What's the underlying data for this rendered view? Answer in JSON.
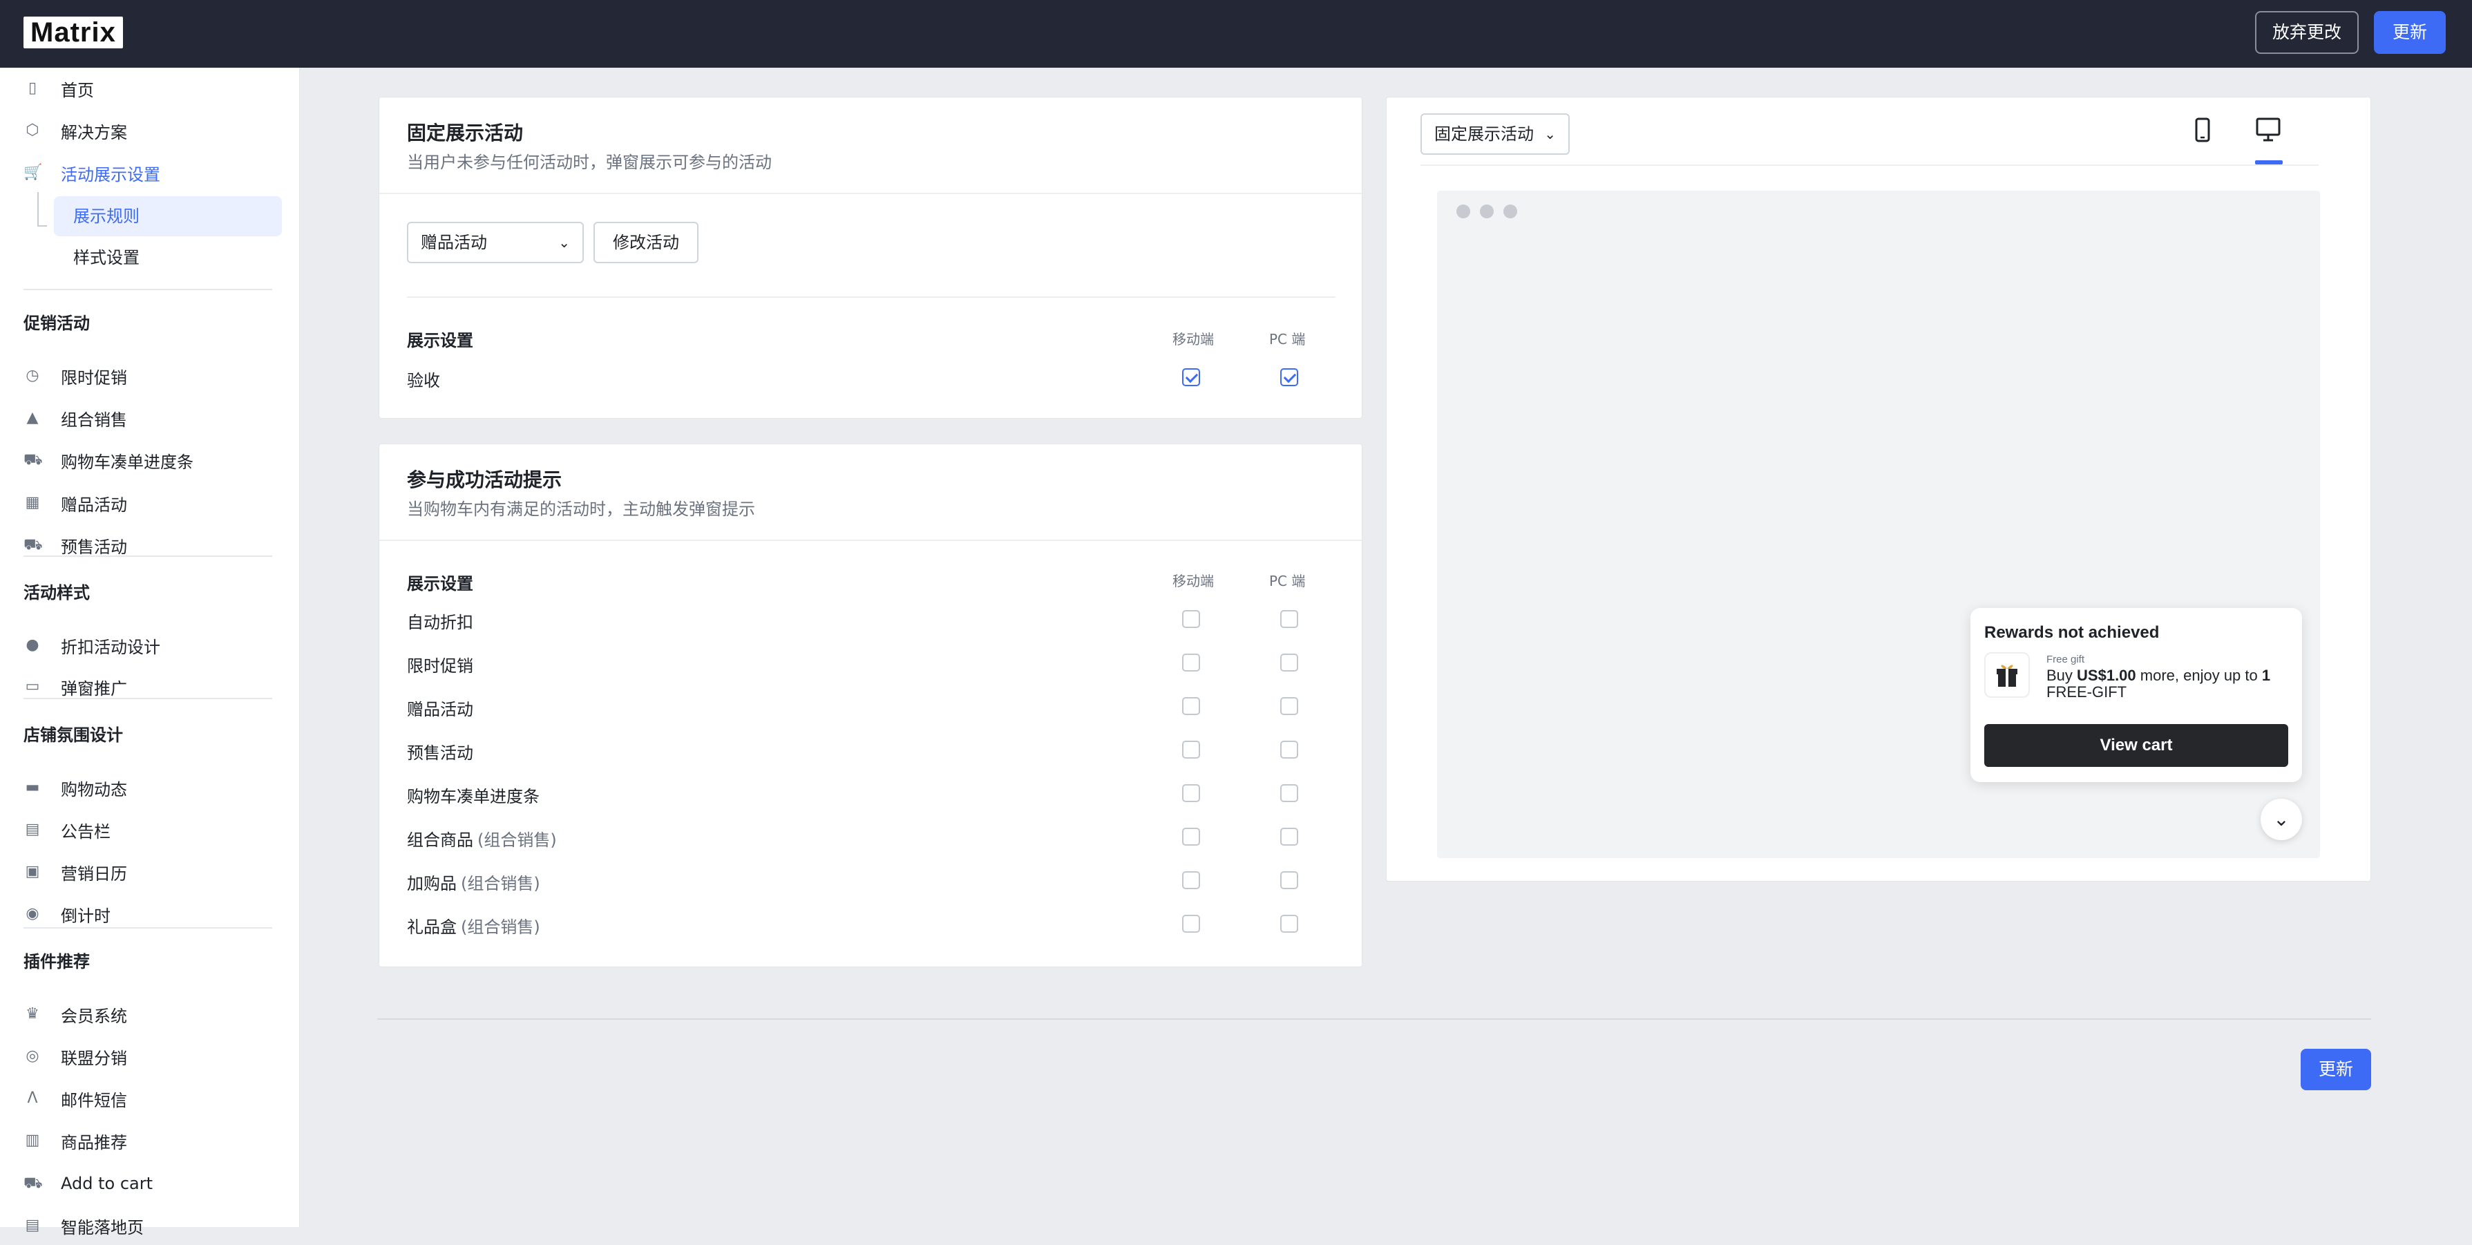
{
  "header": {
    "logo": "Matrix",
    "discard_label": "放弃更改",
    "update_label": "更新"
  },
  "sidebar": {
    "top_items": [
      {
        "label": "首页",
        "icon": "dashboard-icon"
      },
      {
        "label": "解决方案",
        "icon": "box-icon"
      },
      {
        "label": "活动展示设置",
        "icon": "cart-icon"
      }
    ],
    "sub_items": [
      {
        "label": "展示规则"
      },
      {
        "label": "样式设置"
      }
    ],
    "groups": [
      {
        "title": "促销活动",
        "items": [
          {
            "label": "限时促销",
            "icon": "clock-icon"
          },
          {
            "label": "组合销售",
            "icon": "bundle-icon"
          },
          {
            "label": "购物车凑单进度条",
            "icon": "cart-progress-icon"
          },
          {
            "label": "赠品活动",
            "icon": "gift-icon"
          },
          {
            "label": "预售活动",
            "icon": "presale-icon"
          }
        ]
      },
      {
        "title": "活动样式",
        "items": [
          {
            "label": "折扣活动设计",
            "icon": "discount-icon"
          },
          {
            "label": "弹窗推广",
            "icon": "popup-icon"
          }
        ]
      },
      {
        "title": "店铺氛围设计",
        "items": [
          {
            "label": "购物动态",
            "icon": "activity-icon"
          },
          {
            "label": "公告栏",
            "icon": "announcement-icon"
          },
          {
            "label": "营销日历",
            "icon": "calendar-icon"
          },
          {
            "label": "倒计时",
            "icon": "countdown-icon"
          }
        ]
      },
      {
        "title": "插件推荐",
        "items": [
          {
            "label": "会员系统",
            "icon": "crown-icon"
          },
          {
            "label": "联盟分销",
            "icon": "affiliate-icon"
          },
          {
            "label": "邮件短信",
            "icon": "mail-icon"
          },
          {
            "label": "商品推荐",
            "icon": "recommend-icon"
          },
          {
            "label": "Add to cart",
            "icon": "add-cart-icon"
          },
          {
            "label": "智能落地页",
            "icon": "landing-icon"
          }
        ]
      }
    ]
  },
  "fixed_card": {
    "title": "固定展示活动",
    "subtitle": "当用户未参与任何活动时，弹窗展示可参与的活动",
    "select_value": "赠品活动",
    "modify_label": "修改活动",
    "settings_header": "展示设置",
    "col_mobile": "移动端",
    "col_pc": "PC 端",
    "rows": [
      {
        "label": "验收",
        "mobile": true,
        "pc": true
      }
    ]
  },
  "success_card": {
    "title": "参与成功活动提示",
    "subtitle": "当购物车内有满足的活动时，主动触发弹窗提示",
    "settings_header": "展示设置",
    "col_mobile": "移动端",
    "col_pc": "PC 端",
    "rows": [
      {
        "label": "自动折扣",
        "suffix": "",
        "mobile": false,
        "pc": false
      },
      {
        "label": "限时促销",
        "suffix": "",
        "mobile": false,
        "pc": false
      },
      {
        "label": "赠品活动",
        "suffix": "",
        "mobile": false,
        "pc": false
      },
      {
        "label": "预售活动",
        "suffix": "",
        "mobile": false,
        "pc": false
      },
      {
        "label": "购物车凑单进度条",
        "suffix": "",
        "mobile": false,
        "pc": false
      },
      {
        "label": "组合商品",
        "suffix": "(组合销售)",
        "mobile": false,
        "pc": false
      },
      {
        "label": "加购品",
        "suffix": "(组合销售)",
        "mobile": false,
        "pc": false
      },
      {
        "label": "礼品盒",
        "suffix": "(组合销售)",
        "mobile": false,
        "pc": false
      }
    ]
  },
  "preview": {
    "select_value": "固定展示活动",
    "device_tabs": [
      {
        "icon": "mobile-icon"
      },
      {
        "icon": "desktop-icon",
        "active": true
      }
    ],
    "popup": {
      "title": "Rewards not achieved",
      "free_gift_label": "Free gift",
      "offer_pre": "Buy ",
      "offer_amount": "US$1.00",
      "offer_mid": " more, enjoy up to ",
      "offer_qty": "1",
      "offer_end": "FREE-GIFT",
      "button_label": "View cart"
    }
  },
  "footer": {
    "update_label": "更新"
  }
}
